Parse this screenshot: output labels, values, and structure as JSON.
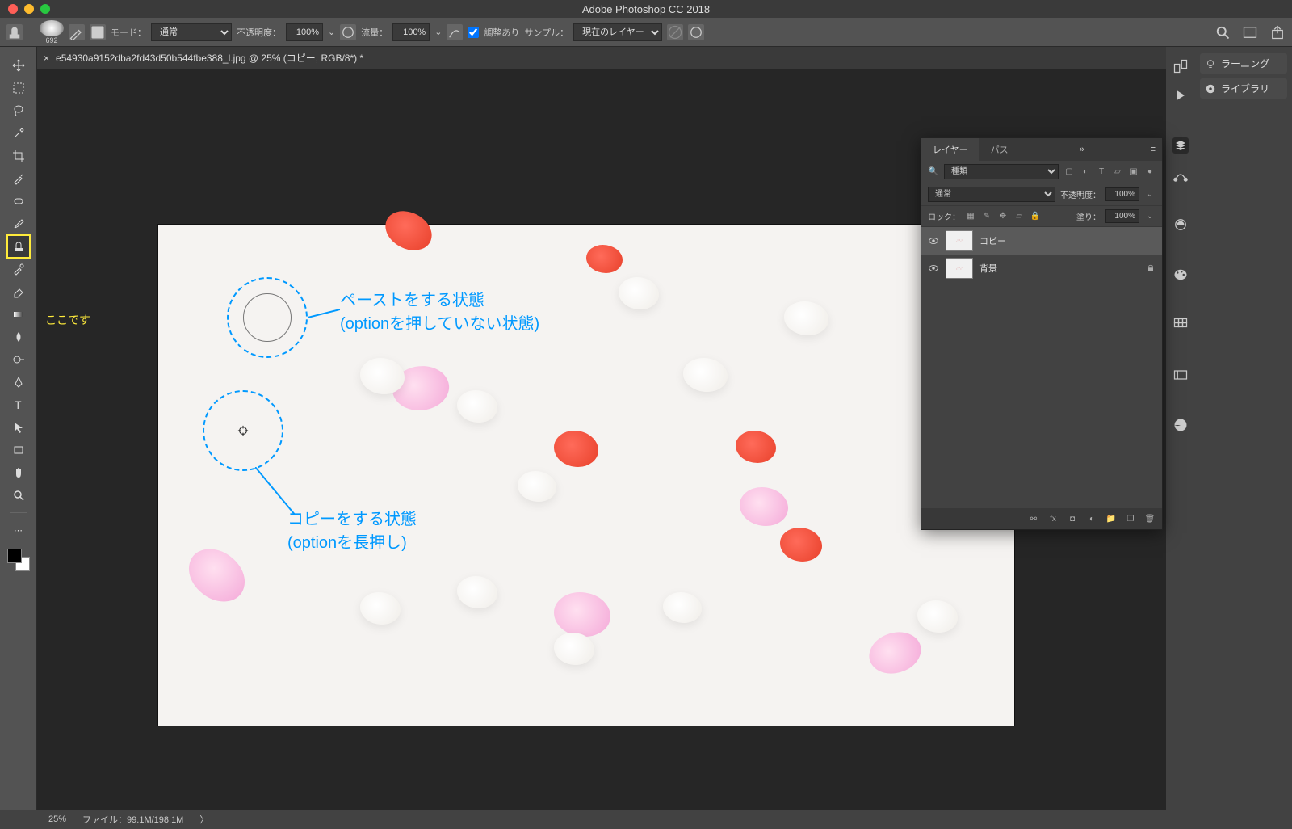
{
  "app": {
    "title": "Adobe Photoshop CC 2018"
  },
  "optionbar": {
    "brush_size": "692",
    "mode_label": "モード：",
    "mode_value": "通常",
    "opacity_label": "不透明度：",
    "opacity_value": "100%",
    "flow_label": "流量：",
    "flow_value": "100%",
    "aligned_label": "調整あり",
    "sample_label": "サンプル：",
    "sample_value": "現在のレイヤー"
  },
  "document": {
    "tab_title": "e54930a9152dba2fd43d50b544fbe388_l.jpg @ 25% (コピー, RGB/8*) *"
  },
  "layers_panel": {
    "tab_layers": "レイヤー",
    "tab_paths": "パス",
    "filter_kind": "種類",
    "blend_mode": "通常",
    "opacity_label": "不透明度：",
    "opacity_value": "100%",
    "lock_label": "ロック：",
    "fill_label": "塗り：",
    "fill_value": "100%",
    "layers": [
      {
        "name": "コピー",
        "selected": true,
        "locked": false
      },
      {
        "name": "背景",
        "selected": false,
        "locked": true
      }
    ]
  },
  "rightpanel": {
    "learning": "ラーニング",
    "libraries": "ライブラリ"
  },
  "annotations": {
    "callout": "ここです",
    "paste_line1": "ペーストをする状態",
    "paste_line2": "(optionを押していない状態)",
    "copy_line1": "コピーをする状態",
    "copy_line2": "(optionを長押し)"
  },
  "status": {
    "zoom": "25%",
    "filesize_label": "ファイル：",
    "filesize": "99.1M/198.1M"
  }
}
